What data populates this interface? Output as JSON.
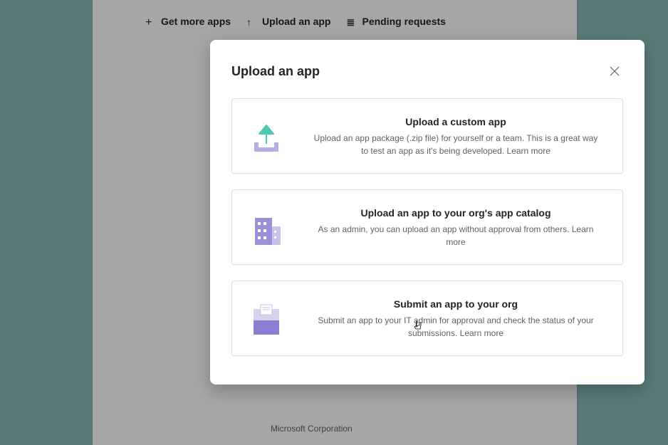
{
  "toolbar": {
    "get_more": "Get more apps",
    "upload": "Upload an app",
    "pending": "Pending requests"
  },
  "footer": {
    "company": "Microsoft Corporation"
  },
  "modal": {
    "title": "Upload an app",
    "options": [
      {
        "title": "Upload a custom app",
        "desc": "Upload an app package (.zip file) for yourself or a team. This is a great way to test an app as it's being developed. ",
        "learn": "Learn more"
      },
      {
        "title": "Upload an app to your org's app catalog",
        "desc": "As an admin, you can upload an app without approval from others. ",
        "learn": "Learn more"
      },
      {
        "title": "Submit an app to your org",
        "desc": "Submit an app to your IT admin for approval and check the status of your submissions. ",
        "learn": "Learn more"
      }
    ]
  }
}
